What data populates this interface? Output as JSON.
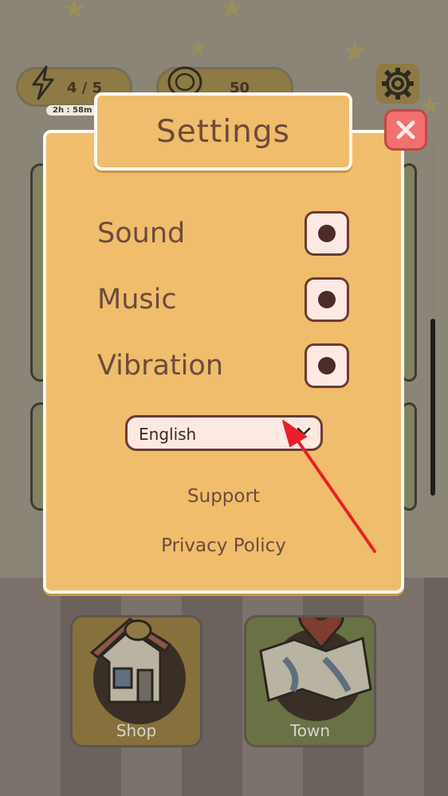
{
  "hud": {
    "energy": "4 / 5",
    "energy_timer": "2h : 58m",
    "coins": "50"
  },
  "dialog": {
    "title": "Settings",
    "settings": [
      {
        "label": "Sound",
        "enabled": true
      },
      {
        "label": "Music",
        "enabled": true
      },
      {
        "label": "Vibration",
        "enabled": true
      }
    ],
    "language": "English",
    "support_link": "Support",
    "privacy_link": "Privacy Policy"
  },
  "bottom_nav": [
    {
      "label": "Shop"
    },
    {
      "label": "Town"
    }
  ],
  "colors": {
    "panel": "#efbd6b",
    "panel_border": "#fff8ef",
    "text_brown": "#6e4a3d",
    "toggle_bg": "#fde9e1",
    "close_red": "#f0716e",
    "annotation_arrow": "#e8202a"
  },
  "icons": [
    "lightning-icon",
    "coin-icon",
    "gear-icon",
    "close-icon",
    "chevron-down-icon",
    "shop-icon",
    "map-pin-icon"
  ]
}
